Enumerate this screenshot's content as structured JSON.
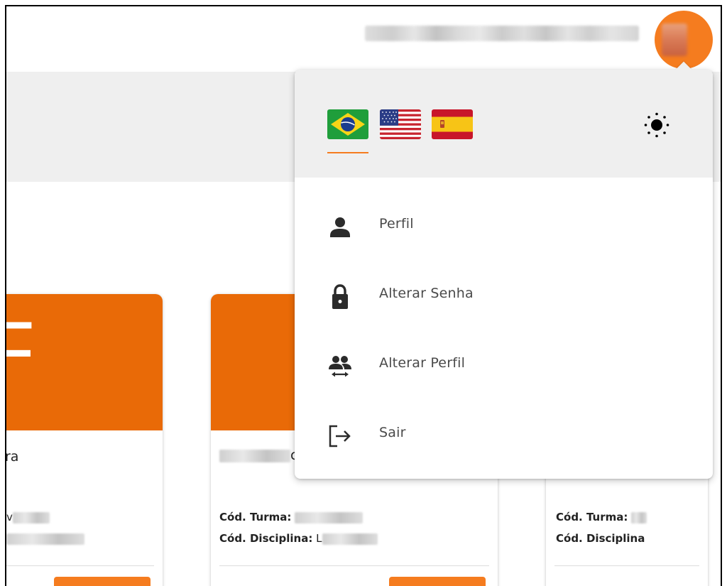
{
  "header": {
    "user_name": "",
    "avatar_color": "#f57c1f"
  },
  "menu": {
    "languages": [
      {
        "name": "Português (Brasil)",
        "icon": "brazil-flag-icon",
        "selected": true
      },
      {
        "name": "English (US)",
        "icon": "usa-flag-icon",
        "selected": false
      },
      {
        "name": "Español",
        "icon": "spain-flag-icon",
        "selected": false
      }
    ],
    "theme_icon": "sun-icon",
    "items": [
      {
        "label": "Perfil",
        "icon": "person-icon"
      },
      {
        "label": "Alterar Senha",
        "icon": "lock-icon"
      },
      {
        "label": "Alterar Perfil",
        "icon": "switch-account-icon"
      },
      {
        "label": "Sair",
        "icon": "logout-icon"
      }
    ]
  },
  "cards": [
    {
      "letter": "F",
      "title_fragment": "ra",
      "line2_fragment": "v"
    },
    {
      "title_fragment": "c",
      "turma_label": "Cód. Turma:",
      "disciplina_label": "Cód. Disciplina:",
      "disciplina_fragment": "L"
    },
    {
      "turma_label": "Cód. Turma:",
      "disciplina_label": "Cód. Disciplina"
    }
  ],
  "colors": {
    "accent": "#f57c1f",
    "card_header": "#e96a07",
    "band": "#efefef"
  }
}
